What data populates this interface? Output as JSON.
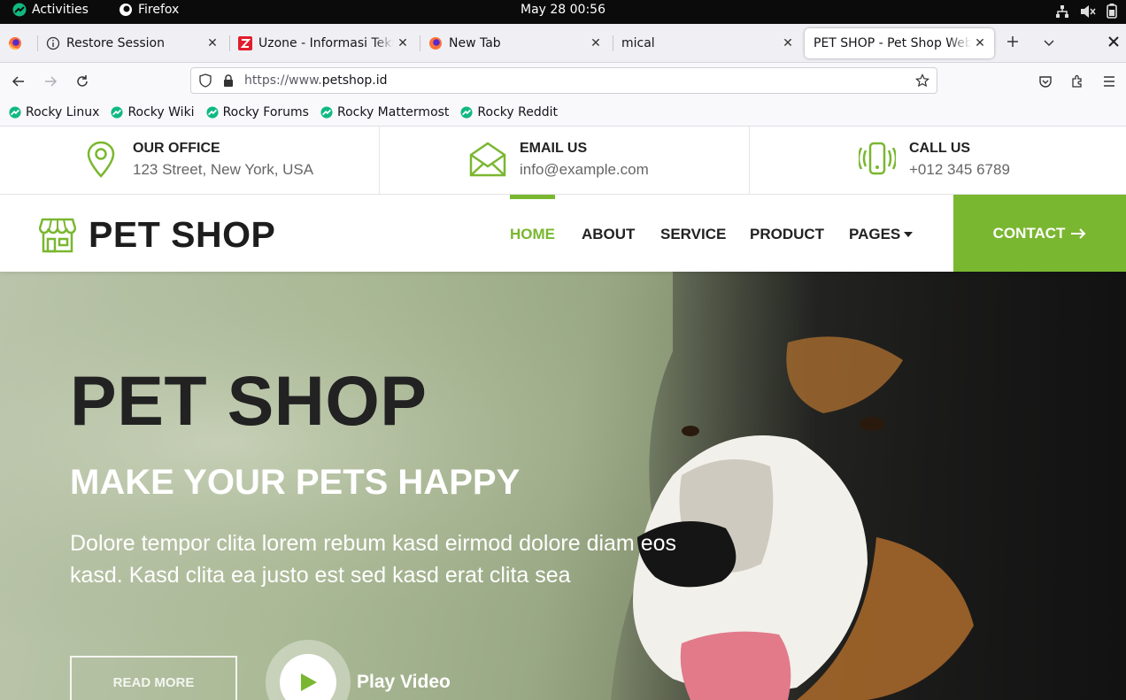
{
  "gnome": {
    "activities": "Activities",
    "app_name": "Firefox",
    "clock": "May 28  00:56"
  },
  "tabs": [
    {
      "label": "Restore Session",
      "icon": "info-icon",
      "active": false
    },
    {
      "label": "Uzone - Informasi Teknologi",
      "icon": "uzone-icon",
      "active": false
    },
    {
      "label": "New Tab",
      "icon": "firefox-icon",
      "active": false
    },
    {
      "label": "mical",
      "icon": "",
      "active": false
    },
    {
      "label": "PET SHOP - Pet Shop Website",
      "icon": "",
      "active": true
    }
  ],
  "url": {
    "prefix": "https://www.",
    "domain": "petshop.id"
  },
  "bookmarks": [
    "Rocky Linux",
    "Rocky Wiki",
    "Rocky Forums",
    "Rocky Mattermost",
    "Rocky Reddit"
  ],
  "colors": {
    "accent": "#7ab730",
    "dark": "#222222"
  },
  "info": {
    "office": {
      "title": "OUR OFFICE",
      "value": "123 Street, New York, USA",
      "icon": "map-pin-icon"
    },
    "email": {
      "title": "EMAIL US",
      "value": "info@example.com",
      "icon": "envelope-icon"
    },
    "call": {
      "title": "CALL US",
      "value": "+012 345 6789",
      "icon": "phone-vibrate-icon"
    }
  },
  "nav": {
    "brand": "PET SHOP",
    "links": [
      "HOME",
      "ABOUT",
      "SERVICE",
      "PRODUCT",
      "PAGES"
    ],
    "active": "HOME",
    "contact": "CONTACT"
  },
  "hero": {
    "title": "PET SHOP",
    "subtitle": "MAKE YOUR PETS HAPPY",
    "description": "Dolore tempor clita lorem rebum kasd eirmod dolore diam eos kasd. Kasd clita ea justo est sed kasd erat clita sea",
    "read_more": "READ MORE",
    "play_video": "Play Video"
  }
}
